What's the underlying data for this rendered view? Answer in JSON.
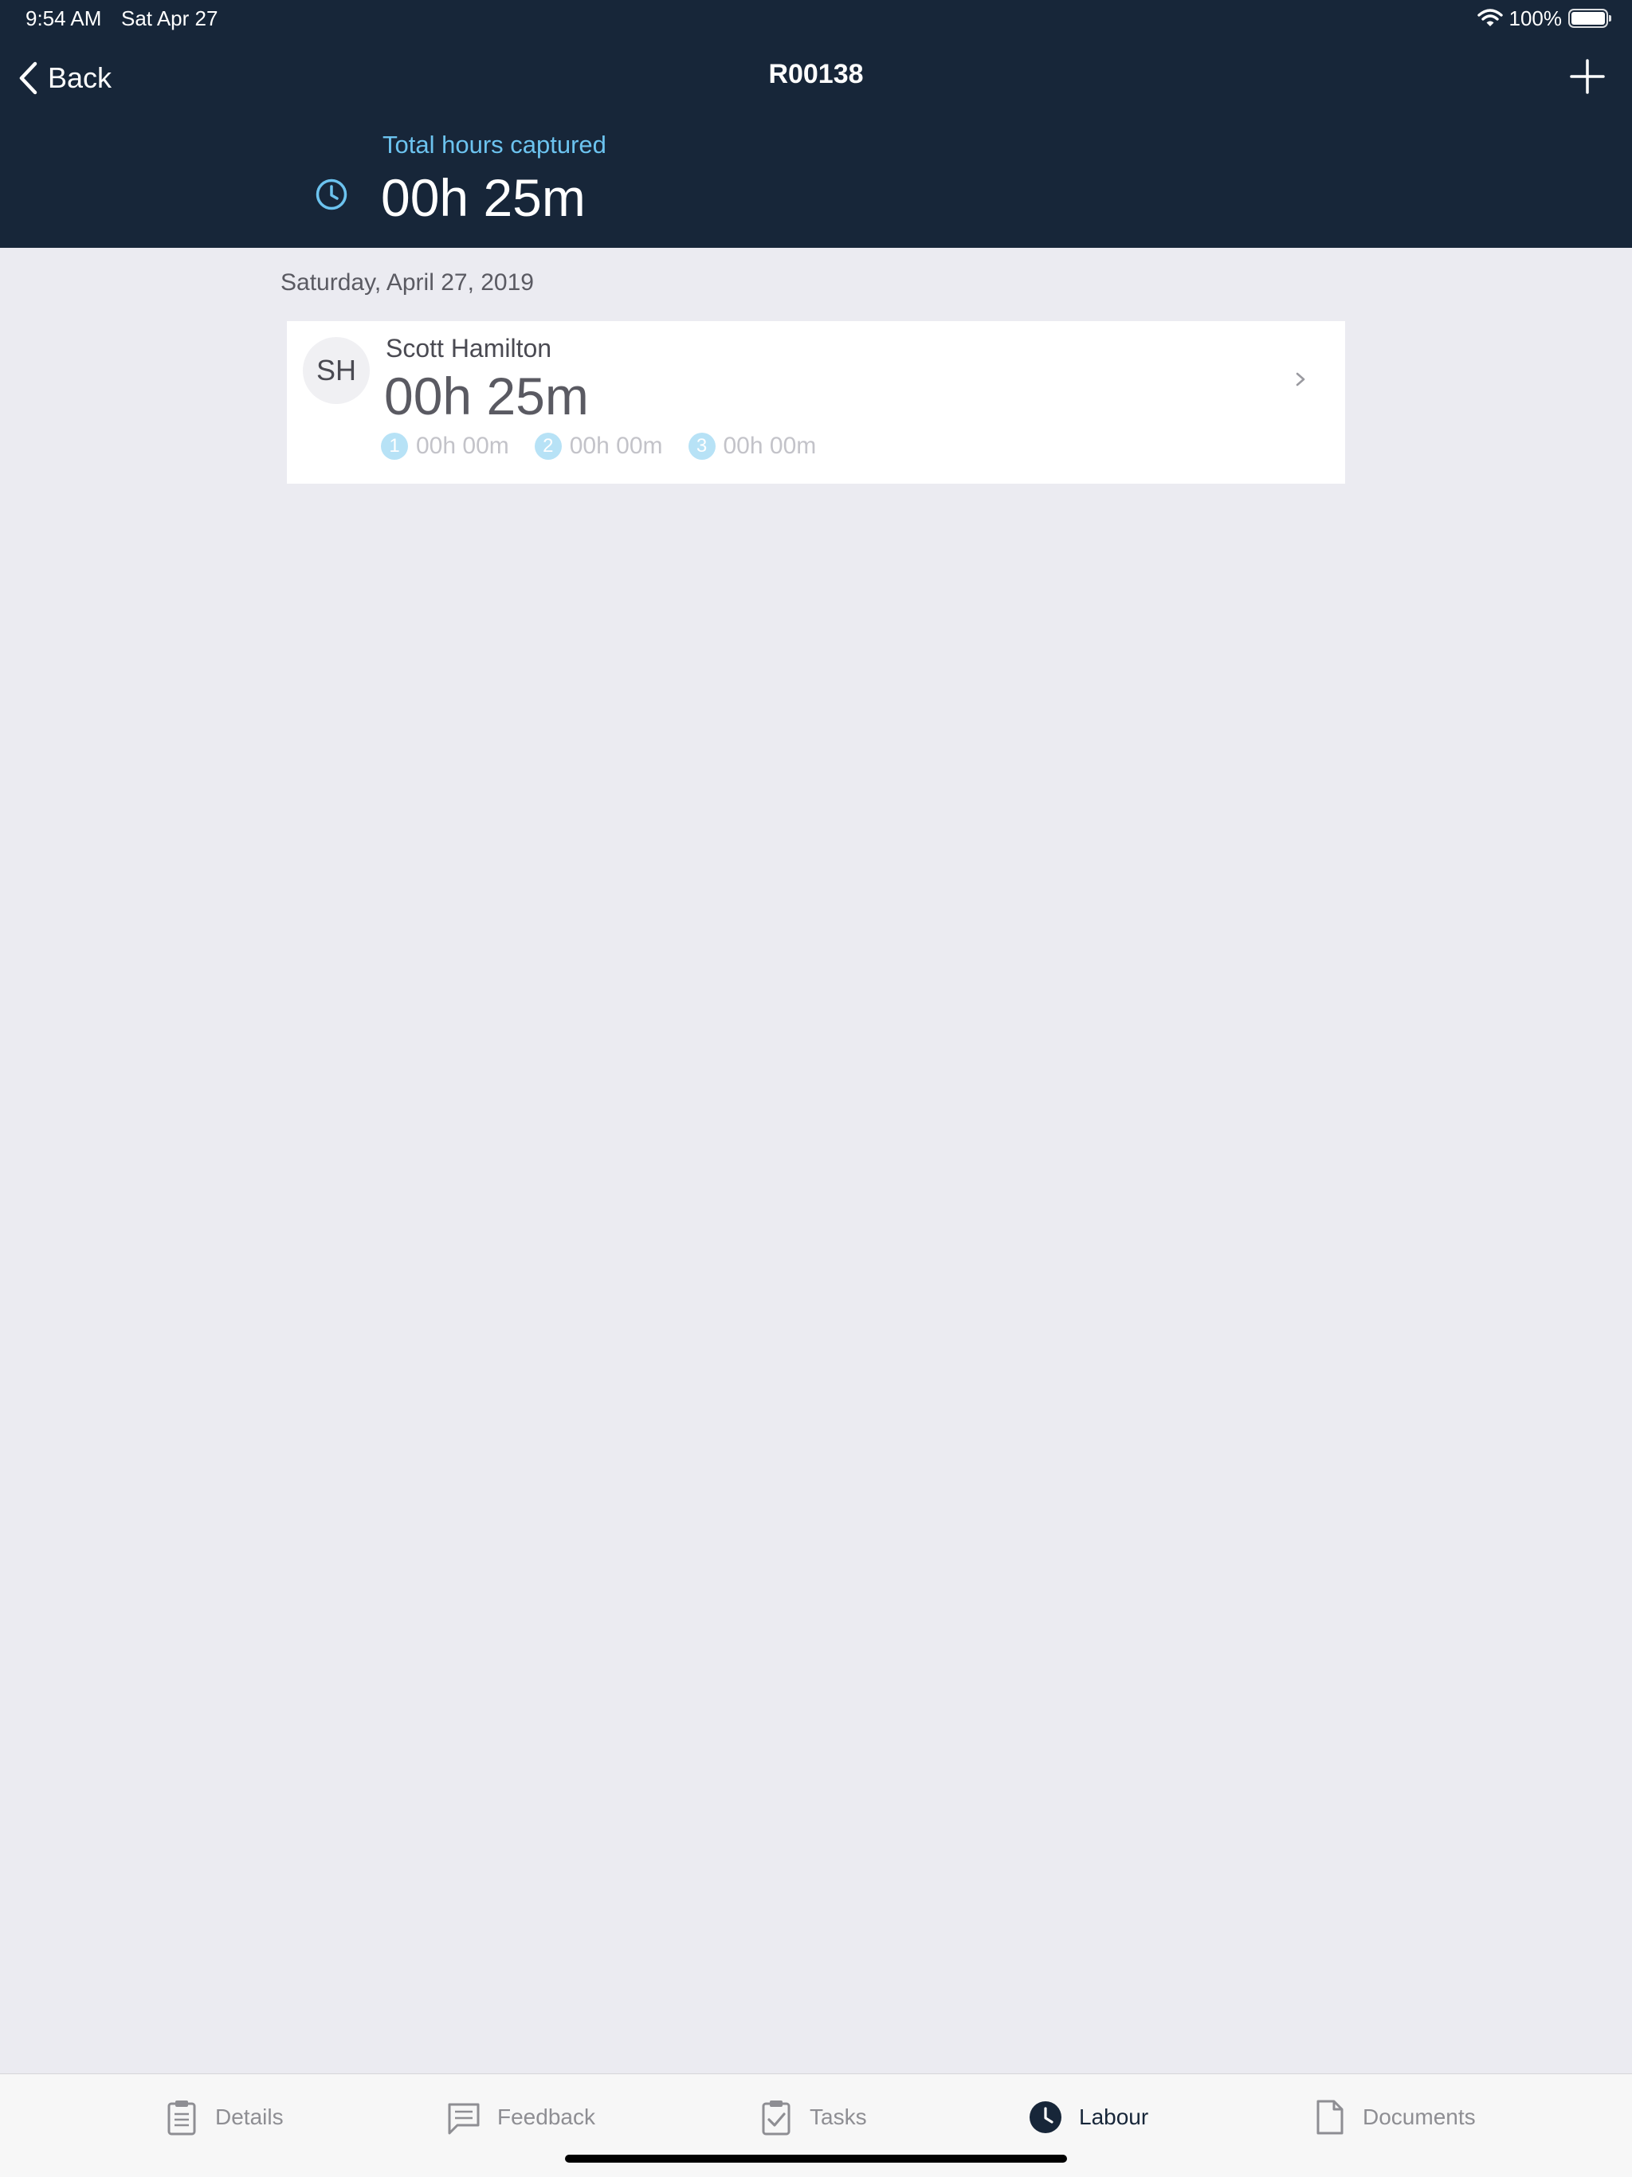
{
  "status_bar": {
    "time": "9:54 AM",
    "date": "Sat Apr 27",
    "battery": "100%"
  },
  "nav": {
    "back_label": "Back",
    "title": "R00138"
  },
  "summary": {
    "label": "Total hours captured",
    "value": "00h 25m"
  },
  "day_group": {
    "date": "Saturday, April 27, 2019"
  },
  "entries": [
    {
      "initials": "SH",
      "name": "Scott Hamilton",
      "hours": "00h 25m",
      "breakdown": [
        {
          "badge": "1",
          "value": "00h 00m"
        },
        {
          "badge": "2",
          "value": "00h 00m"
        },
        {
          "badge": "3",
          "value": "00h 00m"
        }
      ]
    }
  ],
  "tabs": [
    {
      "label": "Details",
      "icon": "clipboard-icon"
    },
    {
      "label": "Feedback",
      "icon": "chat-icon"
    },
    {
      "label": "Tasks",
      "icon": "checklist-icon"
    },
    {
      "label": "Labour",
      "icon": "clock-icon",
      "active": true
    },
    {
      "label": "Documents",
      "icon": "document-icon"
    }
  ],
  "colors": {
    "header_bg": "#172639",
    "accent": "#6cc3ef",
    "page_bg": "#ebebf1",
    "badge": "#b7e2f6"
  }
}
